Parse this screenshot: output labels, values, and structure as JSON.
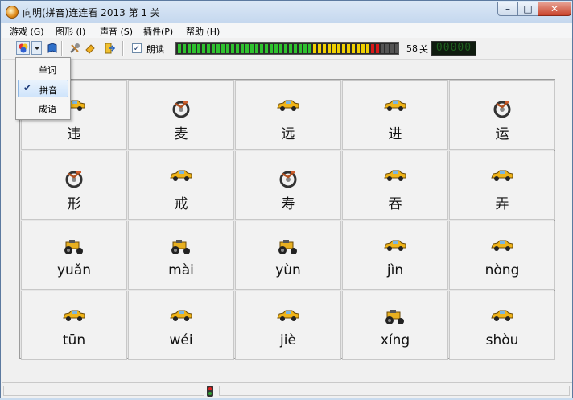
{
  "window": {
    "title": "向明(拼音)连连看 2013   第 1 关",
    "controls": {
      "minimize": "–",
      "maximize": "□",
      "close": "✕"
    }
  },
  "menu": [
    {
      "label": "游戏 (G)"
    },
    {
      "label": "图形 (I)"
    },
    {
      "label": "声音 (S)"
    },
    {
      "label": "插件(P)"
    },
    {
      "label": "帮助 (H)"
    }
  ],
  "toolbar": {
    "read_aloud_label": "朗读",
    "read_aloud_checked": true,
    "time_progress": 0.92,
    "level_value": "58",
    "level_unit": "关",
    "score_display": "00000"
  },
  "dropdown": {
    "items": [
      {
        "label": "单词",
        "checked": false
      },
      {
        "label": "拼音",
        "checked": true
      },
      {
        "label": "成语",
        "checked": false
      }
    ]
  },
  "board": {
    "tiles": [
      {
        "icon": "taxi-icon",
        "text": "违"
      },
      {
        "icon": "motorcycle-icon",
        "text": "麦"
      },
      {
        "icon": "taxi-icon",
        "text": "远"
      },
      {
        "icon": "taxi-icon",
        "text": "进"
      },
      {
        "icon": "motorcycle-icon",
        "text": "运"
      },
      {
        "icon": "motorcycle-icon",
        "text": "形"
      },
      {
        "icon": "taxi-icon",
        "text": "戒"
      },
      {
        "icon": "motorcycle-icon",
        "text": "寿"
      },
      {
        "icon": "taxi-icon",
        "text": "吞"
      },
      {
        "icon": "taxi-icon",
        "text": "弄"
      },
      {
        "icon": "tractor-icon",
        "text": "yuǎn"
      },
      {
        "icon": "tractor-icon",
        "text": "mài"
      },
      {
        "icon": "tractor-icon",
        "text": "yùn"
      },
      {
        "icon": "taxi-icon",
        "text": "jìn"
      },
      {
        "icon": "taxi-icon",
        "text": "nòng"
      },
      {
        "icon": "taxi-icon",
        "text": "tūn"
      },
      {
        "icon": "taxi-icon",
        "text": "wéi"
      },
      {
        "icon": "taxi-icon",
        "text": "jiè"
      },
      {
        "icon": "tractor-icon",
        "text": "xíng"
      },
      {
        "icon": "taxi-icon",
        "text": "shòu"
      }
    ]
  },
  "colors": {
    "progress_green": "#2fc22f",
    "progress_yellow": "#f0d000",
    "progress_red": "#d81818",
    "progress_empty": "#555555"
  }
}
